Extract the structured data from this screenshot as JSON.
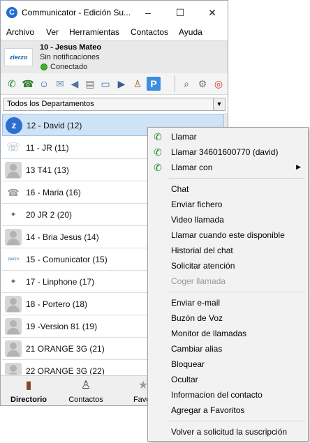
{
  "window": {
    "title": "Communicator - Edición Su...",
    "controls": [
      "–",
      "☐",
      "✕"
    ]
  },
  "menu": [
    "Archivo",
    "Ver",
    "Herramientas",
    "Contactos",
    "Ayuda"
  ],
  "profile": {
    "logo_text": "zierzo",
    "name": "10 - Jesus Mateo",
    "notifications": "Sin notificaciones",
    "status": "Conectado",
    "status_color": "#3fae2a"
  },
  "toolbar_icons": [
    "phone-icon",
    "transfer-icon",
    "group-icon",
    "mail-icon",
    "megaphone-icon",
    "printer-icon",
    "card-icon",
    "video-icon",
    "agent-icon",
    "parking-icon",
    "search-icon",
    "gear-icon",
    "lifebuoy-icon"
  ],
  "department_select": {
    "value": "Todos los Departamentos"
  },
  "contacts": [
    {
      "label": "12 - David (12)",
      "icon": "zierzo-badge",
      "selected": true
    },
    {
      "label": "11 - JR (11)",
      "icon": "device-icon"
    },
    {
      "label": "13 T41 (13)",
      "icon": "person-icon"
    },
    {
      "label": "16 - Maria (16)",
      "icon": "phone-device-icon"
    },
    {
      "label": "20 JR 2 (20)",
      "icon": "small-device-icon"
    },
    {
      "label": "14 - Bria Jesus (14)",
      "icon": "person-icon"
    },
    {
      "label": "15 - Comunicator (15)",
      "icon": "zierzo-logo-icon"
    },
    {
      "label": "17 - Linphone (17)",
      "icon": "small-device-icon"
    },
    {
      "label": "18 - Portero (18)",
      "icon": "person-icon"
    },
    {
      "label": "19 -Version 81 (19)",
      "icon": "person-icon"
    },
    {
      "label": "21 ORANGE 3G (21)",
      "icon": "person-icon"
    },
    {
      "label": "22 ORANGE 3G (22)",
      "icon": "person-icon"
    }
  ],
  "bottom_tabs": [
    {
      "label": "Directorio",
      "icon": "book-icon",
      "active": true
    },
    {
      "label": "Contactos",
      "icon": "agent-icon"
    },
    {
      "label": "Favor",
      "icon": "star-icon"
    }
  ],
  "context_menu": {
    "call": "Llamar",
    "call_number": "Llamar 34601600770 (david)",
    "call_with": "Llamar con",
    "chat": "Chat",
    "send_file": "Enviar fichero",
    "video_call": "Video llamada",
    "call_when_available": "Llamar cuando este disponible",
    "chat_history": "Historial del chat",
    "request_attention": "Solicitar atención",
    "pickup_call": "Coger llamada",
    "send_email": "Enviar e-mail",
    "voicemail": "Buzón de Voz",
    "call_monitor": "Monitor de llamadas",
    "change_alias": "Cambiar alias",
    "block": "Bloquear",
    "hide": "Ocultar",
    "contact_info": "Informacion del contacto",
    "add_favorites": "Agregar a Favoritos",
    "resubscribe": "Volver a solicitud la suscripción"
  }
}
